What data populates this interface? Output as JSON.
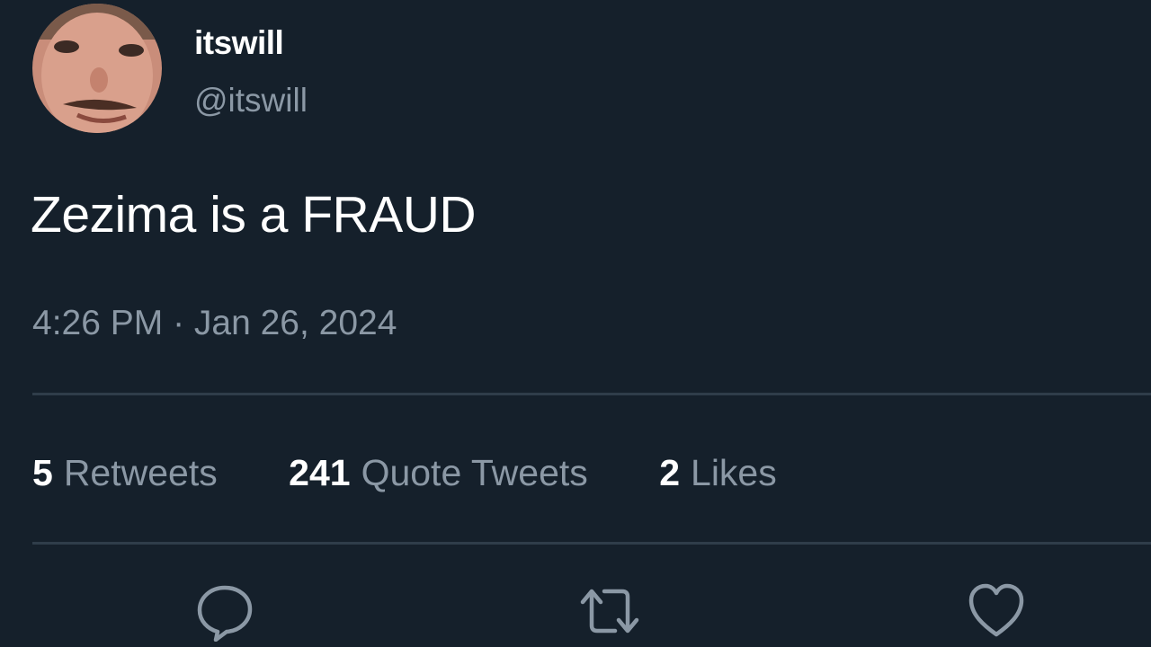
{
  "author": {
    "display_name": "itswill",
    "handle": "@itswill",
    "avatar_icon": "profile-photo-avatar"
  },
  "tweet": {
    "text": "Zezima is a FRAUD",
    "timestamp": "4:26 PM · Jan 26, 2024"
  },
  "stats": [
    {
      "count": "5",
      "label": "Retweets"
    },
    {
      "count": "241",
      "label": "Quote Tweets"
    },
    {
      "count": "2",
      "label": "Likes"
    }
  ],
  "actions": [
    {
      "icon": "reply-icon"
    },
    {
      "icon": "retweet-icon"
    },
    {
      "icon": "like-heart-icon"
    }
  ],
  "colors": {
    "background": "#15202b",
    "primary_text": "#ffffff",
    "secondary_text": "#8b98a5",
    "divider": "#2f3d4a"
  }
}
